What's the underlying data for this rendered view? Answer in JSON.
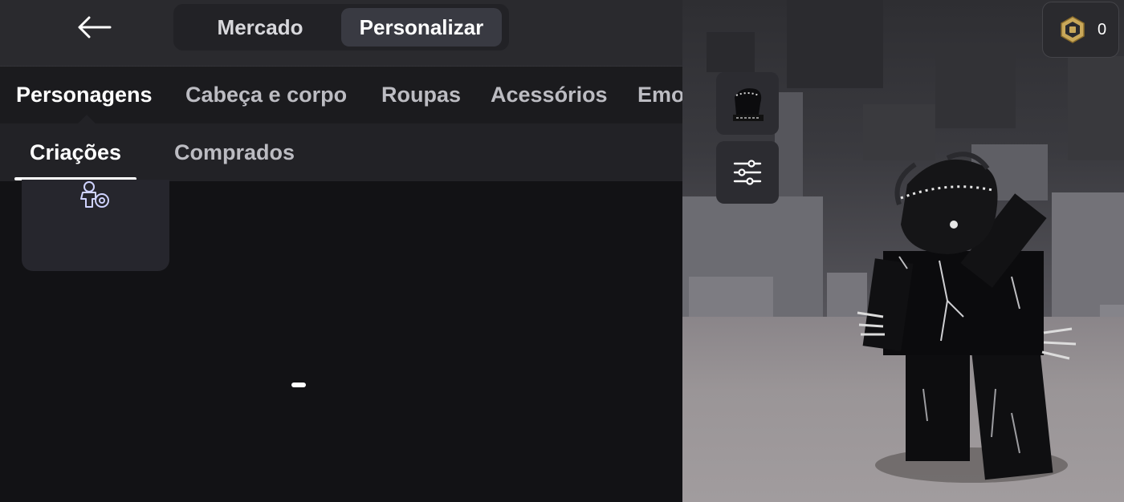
{
  "header": {
    "back_icon": "arrow-left-icon",
    "tabs": [
      {
        "label": "Mercado",
        "active": false
      },
      {
        "label": "Personalizar",
        "active": true
      }
    ]
  },
  "categories": [
    {
      "label": "Personagens",
      "active": true
    },
    {
      "label": "Cabeça e corpo",
      "active": false
    },
    {
      "label": "Roupas",
      "active": false
    },
    {
      "label": "Acessórios",
      "active": false
    },
    {
      "label": "Emo",
      "active": false
    }
  ],
  "subtabs": [
    {
      "label": "Criações",
      "active": true
    },
    {
      "label": "Comprados",
      "active": false
    }
  ],
  "create_card_icon": "character-settings-icon",
  "tools": {
    "avatar_icon": "avatar-thumbnail-icon",
    "filter_icon": "sliders-icon"
  },
  "currency": {
    "icon": "robux-icon",
    "amount": "0"
  },
  "colors": {
    "accent": "#ffffff",
    "panel": "#222226",
    "robux_gold": "#c9a85a"
  }
}
